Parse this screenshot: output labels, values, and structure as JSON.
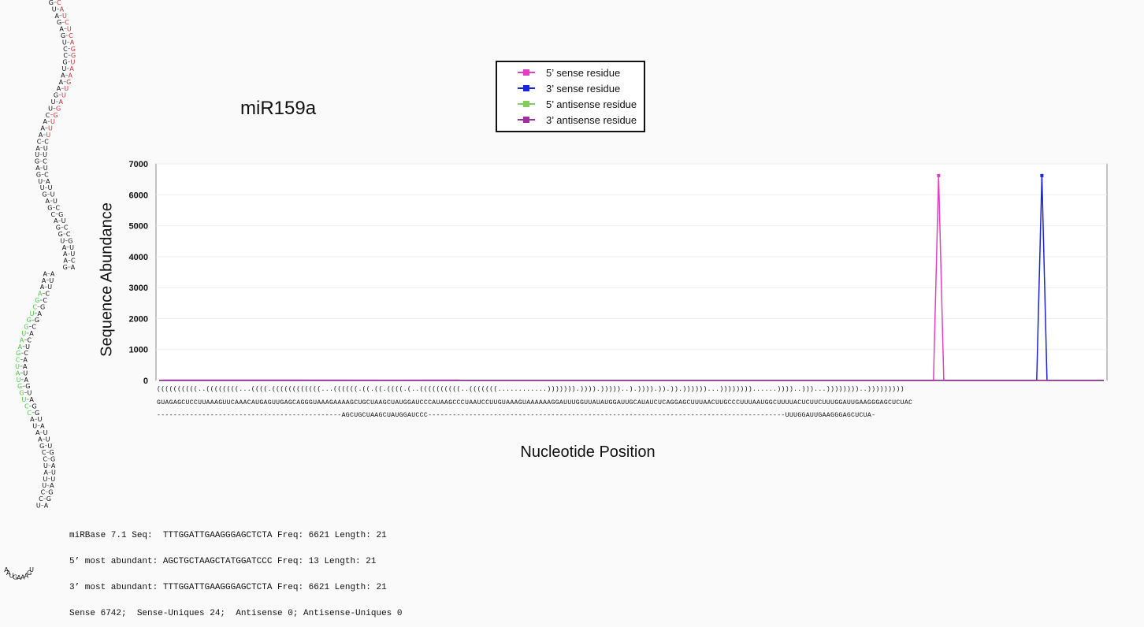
{
  "title": "miR159a",
  "legend": [
    {
      "label": "5’ sense residue",
      "color": "#e23fc4",
      "marker": "#e23fc4"
    },
    {
      "label": "3’ sense residue",
      "color": "#1a24d8",
      "marker": "#1a24d8"
    },
    {
      "label": "5’ antisense residue",
      "color": "#7fd05a",
      "marker": "#7fd05a"
    },
    {
      "label": "3’ antisense residue",
      "color": "#a030a0",
      "marker": "#a030a0"
    }
  ],
  "chart_data": {
    "type": "line",
    "title": "miR159a",
    "xlabel": "Nucleotide Position",
    "ylabel": "Sequence Abundance",
    "ylim": [
      0,
      7000
    ],
    "yticks": [
      "0",
      "1000",
      "2000",
      "3000",
      "4000",
      "5000",
      "6000",
      "7000"
    ],
    "x_count": 184,
    "series": [
      {
        "name": "5’ sense residue",
        "color": "#e23fc4",
        "points": [
          [
            0,
            0
          ],
          [
            1,
            13
          ],
          [
            44,
            10
          ],
          [
            58,
            13
          ],
          [
            150,
            0
          ],
          [
            151,
            6621
          ],
          [
            152,
            0
          ],
          [
            183,
            0
          ]
        ]
      },
      {
        "name": "3’ sense residue",
        "color": "#1a24d8",
        "points": [
          [
            0,
            0
          ],
          [
            170,
            0
          ],
          [
            171,
            6621
          ],
          [
            172,
            0
          ],
          [
            183,
            0
          ]
        ]
      },
      {
        "name": "5’ antisense residue",
        "color": "#7fd05a",
        "points": [
          [
            0,
            0
          ],
          [
            183,
            0
          ]
        ]
      },
      {
        "name": "3’ antisense residue",
        "color": "#a030a0",
        "points": [
          [
            0,
            0
          ],
          [
            183,
            0
          ]
        ]
      }
    ]
  },
  "sequence": {
    "structure": "((((((((((..((((((((...((((.((((((((((((...((((((.((.((.((((.(..((((((((((..(((((((............))))))).)))).)))))..).)))).)).)).))))))...))))))))......))))..)))...))))))))..)))))))))",
    "precursor": "GUAGAGCUCCUUAAAGUUCAAACAUGAGUUGAGCAGGGUAAAGAAAAGCUGCUAAGCUAUGGAUCCCAUAAGCCCUAAUCCUUGUAAAGUAAAAAAGGAUUUGGUUAUAUGGAUUGCAUAUCUCAGGAGCUUUAACUUGCCCUUUAAUGGCUUUUACUCUUCUUUGGAUUGAAGGGAGCUCUAC",
    "mature": "---------------------------------------------AGCUGCUAAGCUAUGGAUCCC---------------------------------------------------------------------------------------UUUGGAUUGAAGGGAGCUCUA-"
  },
  "stats": [
    "miRBase 7.1 Seq:  TTTGGATTGAAGGGAGCTCTA Freq: 6621 Length: 21",
    "5’ most abundant: AGCTGCTAAGCTATGGATCCC Freq: 13 Length: 21",
    "3’ most abundant: TTTGGATTGAAGGGAGCTCTA Freq: 6621 Length: 21",
    "Sense 6742;  Sense-Uniques 24;  Antisense 0; Antisense-Uniques 0"
  ],
  "hairpin": [
    {
      "l": "G",
      "r": "C",
      "rc": "#cc3333"
    },
    {
      "l": "U",
      "r": "A",
      "rc": "#cc3333"
    },
    {
      "l": "A",
      "r": "U",
      "rc": "#cc3333"
    },
    {
      "l": "G",
      "r": "C",
      "rc": "#cc3333"
    },
    {
      "l": "A",
      "r": "U",
      "rc": "#cc3333"
    },
    {
      "l": "G",
      "r": "C",
      "rc": "#cc3333"
    },
    {
      "l": "U",
      "r": "A",
      "rc": "#cc3333"
    },
    {
      "l": "C",
      "r": "G",
      "rc": "#cc3333"
    },
    {
      "l": "C",
      "r": "G",
      "rc": "#cc3333"
    },
    {
      "l": "G",
      "r": "U",
      "rc": "#cc3333"
    },
    {
      "l": "U",
      "r": "A",
      "rc": "#cc3333"
    },
    {
      "l": "A",
      "r": "A",
      "rc": "#cc3333"
    },
    {
      "l": "A",
      "r": "G",
      "rc": "#cc3333"
    },
    {
      "l": "A",
      "r": "U",
      "rc": "#cc3333"
    },
    {
      "l": "G",
      "r": "U",
      "rc": "#cc3333"
    },
    {
      "l": "U",
      "r": "A",
      "rc": "#cc3333"
    },
    {
      "l": "U",
      "r": "G",
      "rc": "#cc3333"
    },
    {
      "l": "C",
      "r": "G",
      "rc": "#cc3333"
    },
    {
      "l": "A",
      "r": "U",
      "rc": "#cc3333"
    },
    {
      "l": "A",
      "r": "U",
      "rc": "#cc3333"
    },
    {
      "l": "A",
      "r": "U",
      "rc": "#cc3333"
    },
    {
      "l": "C",
      "r": "C",
      "rc": "#111"
    },
    {
      "l": "A",
      "r": "U",
      "rc": "#111"
    },
    {
      "l": "U",
      "r": "U",
      "rc": "#111"
    },
    {
      "l": "G",
      "r": "C",
      "rc": "#111"
    },
    {
      "l": "A",
      "r": "U",
      "rc": "#111"
    },
    {
      "l": "G",
      "r": "C",
      "rc": "#111"
    },
    {
      "l": "U",
      "r": "A",
      "rc": "#111"
    },
    {
      "l": "U",
      "r": "U",
      "rc": "#111"
    },
    {
      "l": "G",
      "r": "U",
      "rc": "#111"
    },
    {
      "l": "A",
      "r": "U",
      "rc": "#111"
    },
    {
      "l": "G",
      "r": "C",
      "rc": "#111"
    },
    {
      "l": "C",
      "r": "G",
      "rc": "#111"
    },
    {
      "l": "A",
      "r": "U",
      "rc": "#111"
    },
    {
      "l": "G",
      "r": "C",
      "rc": "#111"
    },
    {
      "l": "G",
      "r": "C",
      "rc": "#111"
    },
    {
      "l": "U",
      "r": "G",
      "rc": "#111"
    },
    {
      "l": "A",
      "r": "U",
      "rc": "#111"
    },
    {
      "l": "A",
      "r": "U",
      "rc": "#111"
    },
    {
      "l": "A",
      "r": "C",
      "rc": "#111"
    },
    {
      "l": "G",
      "r": "A",
      "rc": "#111"
    },
    {
      "l": "A",
      "r": "A",
      "rc": "#111"
    },
    {
      "l": "A",
      "r": "U",
      "rc": "#111"
    },
    {
      "l": "A",
      "r": "U",
      "rc": "#111"
    },
    {
      "l": "A",
      "r": "C",
      "lc": "#44cc44",
      "rc": "#111"
    },
    {
      "l": "G",
      "r": "C",
      "lc": "#44cc44",
      "rc": "#111"
    },
    {
      "l": "C",
      "r": "G",
      "lc": "#44cc44",
      "rc": "#111"
    },
    {
      "l": "U",
      "r": "A",
      "lc": "#44cc44",
      "rc": "#111"
    },
    {
      "l": "G",
      "r": "G",
      "lc": "#44cc44",
      "rc": "#111"
    },
    {
      "l": "G",
      "r": "C",
      "lc": "#44cc44",
      "rc": "#111"
    },
    {
      "l": "U",
      "r": "A",
      "lc": "#44cc44",
      "rc": "#111"
    },
    {
      "l": "A",
      "r": "C",
      "lc": "#44cc44",
      "rc": "#111"
    },
    {
      "l": "A",
      "r": "U",
      "lc": "#44cc44",
      "rc": "#111"
    },
    {
      "l": "G",
      "r": "C",
      "lc": "#44cc44",
      "rc": "#111"
    },
    {
      "l": "C",
      "r": "A",
      "lc": "#44cc44",
      "rc": "#111"
    },
    {
      "l": "U",
      "r": "A",
      "lc": "#44cc44",
      "rc": "#111"
    },
    {
      "l": "A",
      "r": "U",
      "lc": "#44cc44",
      "rc": "#111"
    },
    {
      "l": "U",
      "r": "A",
      "lc": "#44cc44",
      "rc": "#111"
    },
    {
      "l": "G",
      "r": "G",
      "lc": "#44cc44",
      "rc": "#111"
    },
    {
      "l": "G",
      "r": "U",
      "lc": "#44cc44",
      "rc": "#111"
    },
    {
      "l": "U",
      "r": "A",
      "lc": "#44cc44",
      "rc": "#111"
    },
    {
      "l": "C",
      "r": "G",
      "lc": "#44cc44",
      "rc": "#111"
    },
    {
      "l": "C",
      "r": "G",
      "lc": "#44cc44",
      "rc": "#111"
    },
    {
      "l": "A",
      "r": "U",
      "rc": "#111"
    },
    {
      "l": "U",
      "r": "A",
      "rc": "#111"
    },
    {
      "l": "A",
      "r": "U",
      "rc": "#111"
    },
    {
      "l": "A",
      "r": "U",
      "rc": "#111"
    },
    {
      "l": "G",
      "r": "U",
      "rc": "#111"
    },
    {
      "l": "C",
      "r": "G",
      "rc": "#111"
    },
    {
      "l": "C",
      "r": "G",
      "rc": "#111"
    },
    {
      "l": "U",
      "r": "A",
      "rc": "#111"
    },
    {
      "l": "A",
      "r": "U",
      "rc": "#111"
    },
    {
      "l": "U",
      "r": "U",
      "rc": "#111"
    },
    {
      "l": "U",
      "r": "A",
      "rc": "#111"
    },
    {
      "l": "C",
      "r": "G",
      "rc": "#111"
    },
    {
      "l": "C",
      "r": "G",
      "rc": "#111"
    },
    {
      "l": "U",
      "r": "A",
      "rc": "#111"
    }
  ],
  "hairpin_loop": [
    "U",
    "G",
    "A",
    "A",
    "A",
    "G",
    "U",
    "A",
    "A"
  ]
}
